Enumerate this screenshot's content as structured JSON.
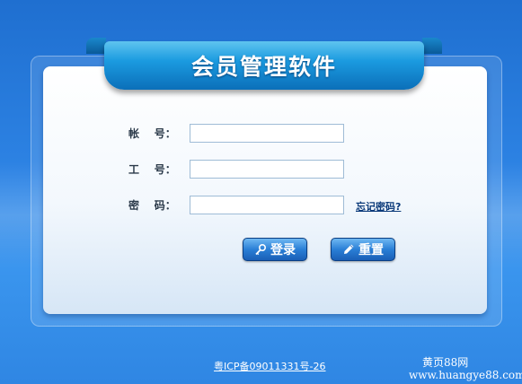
{
  "app": {
    "title": "会员管理软件"
  },
  "form": {
    "account_label": "帐    号：",
    "worker_id_label": "工    号：",
    "password_label": "密    码：",
    "account_value": "",
    "worker_id_value": "",
    "password_value": "",
    "forgot_password": "忘记密码?"
  },
  "buttons": {
    "login_label": "登录",
    "login_icon": "key-icon",
    "reset_label": "重置",
    "reset_icon": "pencil-icon"
  },
  "footer": {
    "icp": "粤ICP备09011331号-26"
  },
  "watermark": {
    "site_name": "黄页88网",
    "url": "www.huangye88.com"
  }
}
